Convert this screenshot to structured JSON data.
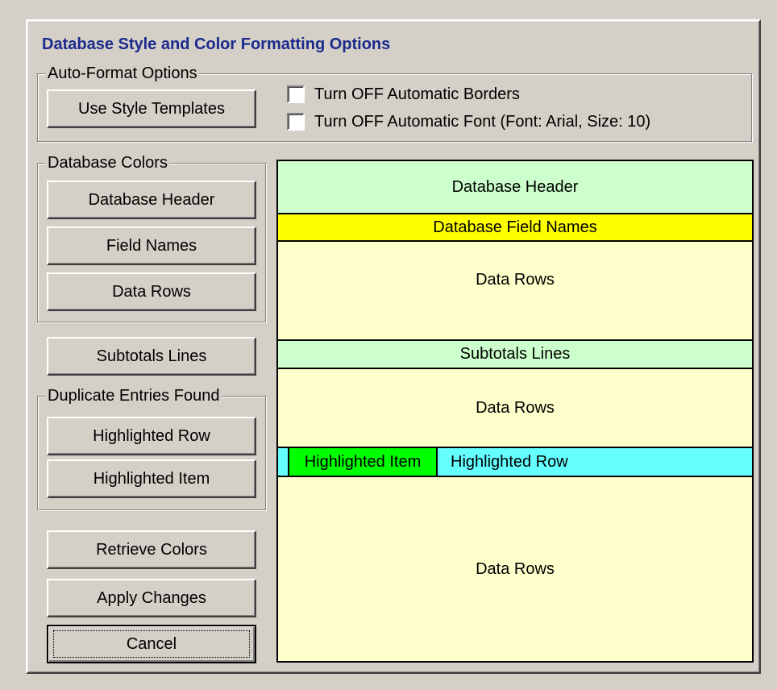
{
  "dialog": {
    "title": "Database Style and Color Formatting Options"
  },
  "auto_format": {
    "group_label": "Auto-Format Options",
    "template_button": "Use Style Templates",
    "checkbox_borders": {
      "label": "Turn OFF Automatic Borders",
      "checked": false
    },
    "checkbox_font": {
      "label": "Turn OFF Automatic Font (Font: Arial,  Size: 10)",
      "checked": false
    }
  },
  "database_colors": {
    "group_label": "Database Colors",
    "header_button": "Database Header",
    "field_names_button": "Field Names",
    "data_rows_button": "Data Rows"
  },
  "subtotals_button": "Subtotals Lines",
  "duplicates": {
    "group_label": "Duplicate Entries Found",
    "row_button": "Highlighted Row",
    "item_button": "Highlighted Item"
  },
  "actions": {
    "retrieve": "Retrieve Colors",
    "apply": "Apply Changes",
    "cancel": "Cancel"
  },
  "preview": {
    "header": {
      "label": "Database Header",
      "color": "#ccffcc"
    },
    "field_names": {
      "label": "Database Field Names",
      "color": "#ffff00"
    },
    "data_rows_1": {
      "label": "Data Rows",
      "color": "#ffffcc"
    },
    "subtotals": {
      "label": "Subtotals Lines",
      "color": "#ccffcc"
    },
    "data_rows_2": {
      "label": "Data Rows",
      "color": "#ffffcc"
    },
    "highlighted_row": {
      "label": "Highlighted Row",
      "color": "#66ffff"
    },
    "highlighted_item": {
      "label": "Highlighted Item",
      "color": "#00ff00"
    },
    "data_rows_3": {
      "label": "Data Rows",
      "color": "#ffffcc"
    }
  }
}
